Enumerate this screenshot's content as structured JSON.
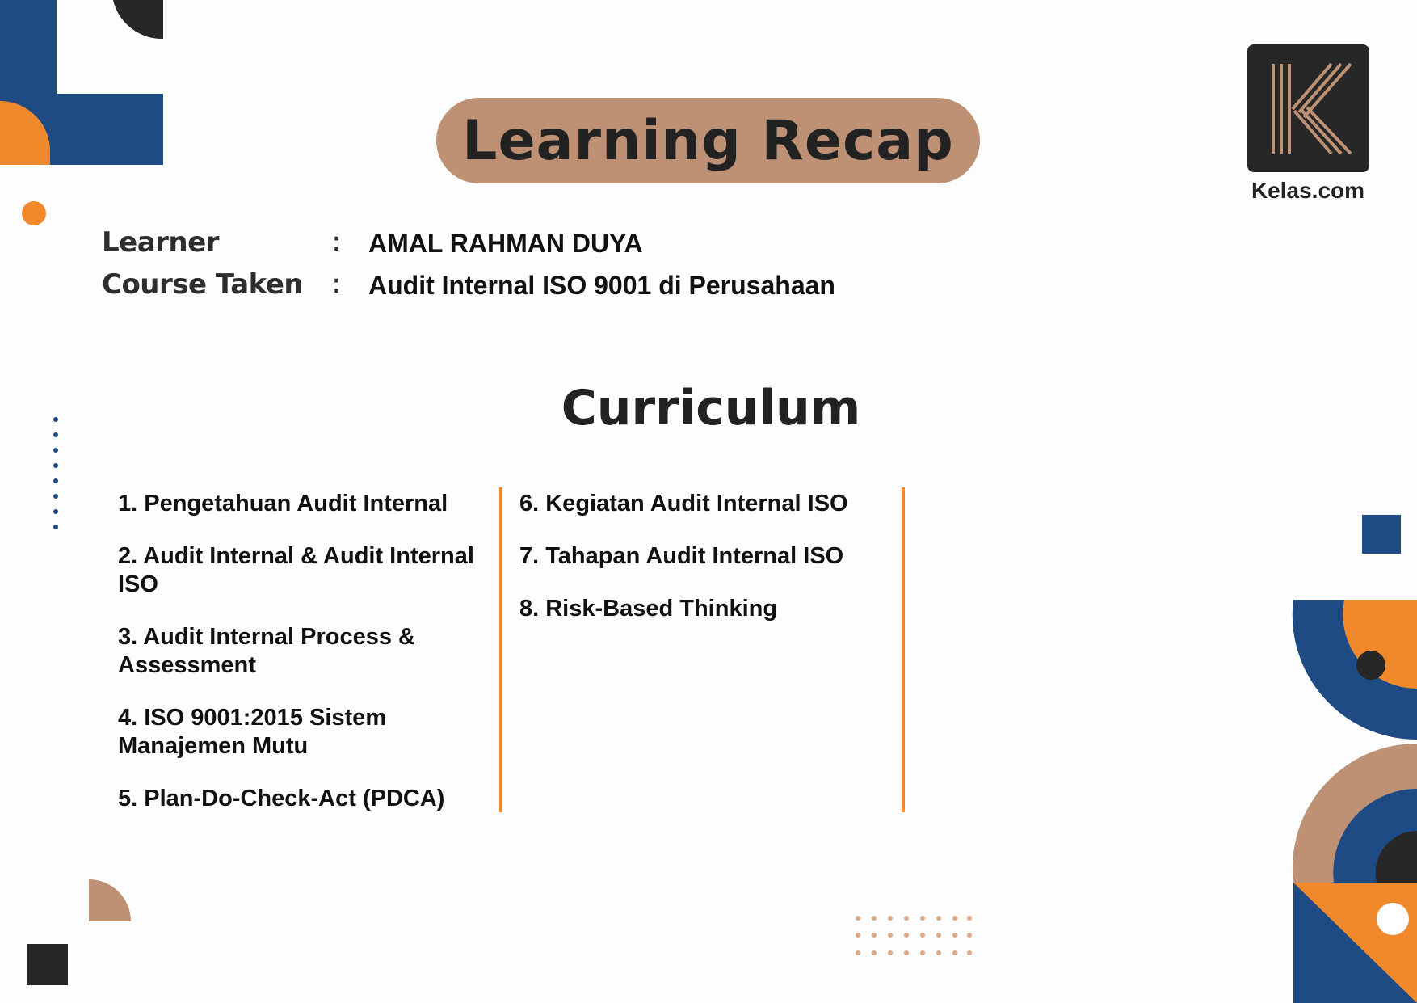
{
  "header": {
    "title": "Learning Recap",
    "logo_text": "Kelas.com",
    "logo_icon": "k-monogram-icon"
  },
  "info": {
    "learner_label": "Learner",
    "learner_value": "AMAL RAHMAN DUYA",
    "course_label": "Course Taken",
    "course_value": "Audit Internal ISO 9001 di Perusahaan",
    "separator": ":"
  },
  "curriculum": {
    "title": "Curriculum",
    "left_items": [
      "1. Pengetahuan Audit Internal",
      "2. Audit Internal & Audit Internal ISO",
      "3. Audit Internal Process & Assessment",
      "4. ISO 9001:2015 Sistem Manajemen Mutu",
      "5. Plan-Do-Check-Act (PDCA)"
    ],
    "right_items": [
      "6. Kegiatan Audit Internal ISO",
      "7. Tahapan Audit Internal ISO",
      "8. Risk-Based Thinking"
    ]
  },
  "colors": {
    "navy": "#1f4b85",
    "orange": "#f0892b",
    "tan": "#be9174",
    "dark": "#272727"
  }
}
